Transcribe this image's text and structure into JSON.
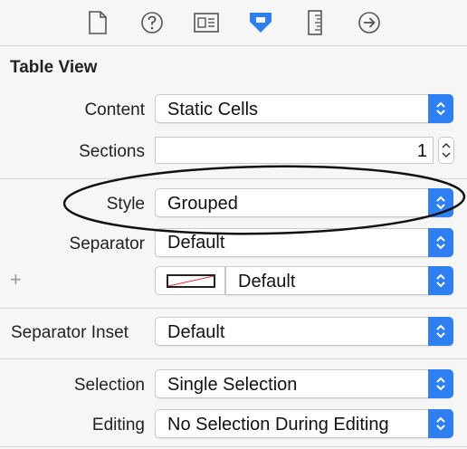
{
  "toolbar": {
    "icons": [
      "file-inspector-icon",
      "quick-help-icon",
      "identity-inspector-icon",
      "attributes-inspector-icon",
      "size-inspector-icon",
      "connections-inspector-icon"
    ],
    "active_icon": "attributes-inspector-icon",
    "accent_color": "#2f7ff0"
  },
  "section": {
    "title": "Table View"
  },
  "fields": {
    "content": {
      "label": "Content",
      "value": "Static Cells"
    },
    "sections": {
      "label": "Sections",
      "value": "1"
    },
    "style": {
      "label": "Style",
      "value": "Grouped"
    },
    "separator": {
      "label": "Separator",
      "value": "Default",
      "color_value": "Default"
    },
    "separator_inset": {
      "label": "Separator Inset",
      "value": "Default"
    },
    "selection": {
      "label": "Selection",
      "value": "Single Selection"
    },
    "editing": {
      "label": "Editing",
      "value": "No Selection During Editing"
    }
  },
  "plus_symbol": "+"
}
